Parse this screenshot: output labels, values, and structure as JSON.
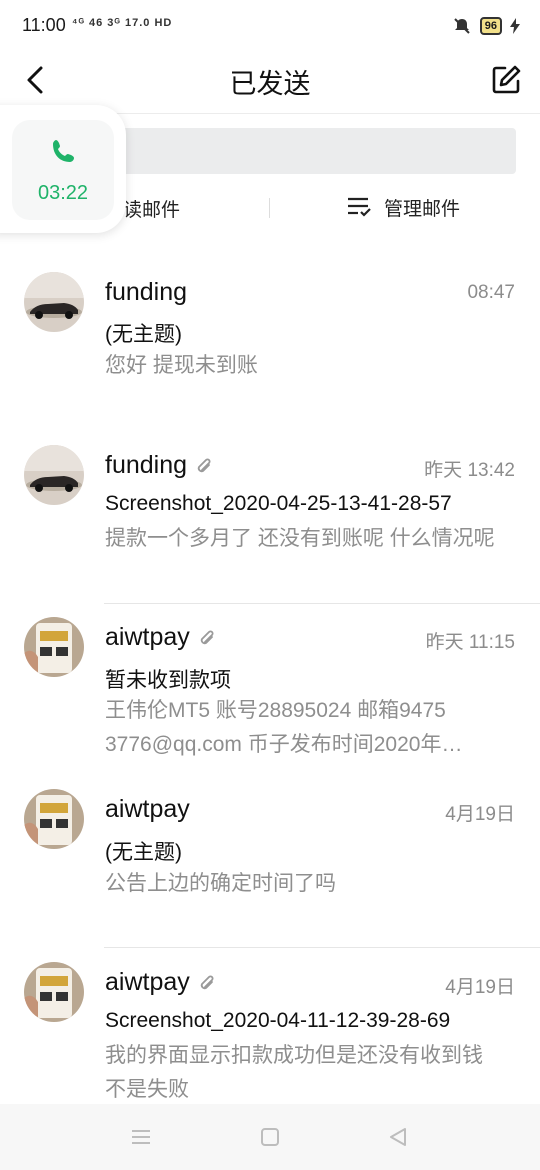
{
  "status_bar": {
    "time": "11:00",
    "network": "⁴ᴳ 46 3ᴳ 17.0 HD",
    "battery": "96"
  },
  "header": {
    "title": "已发送",
    "back_icon": "chevron-left-icon",
    "compose_icon": "compose-icon"
  },
  "search": {
    "placeholder": ""
  },
  "actions": {
    "unread_label": "未读邮件",
    "manage_label": "管理邮件"
  },
  "call_widget": {
    "timer": "03:22",
    "icon": "phone-icon",
    "accent": "#1fb369"
  },
  "mails": [
    {
      "sender": "funding",
      "time": "08:47",
      "subject": "(无主题)",
      "preview": "您好 提现未到账",
      "has_attachment": false,
      "avatar": "car"
    },
    {
      "sender": "funding",
      "time": "昨天 13:42",
      "subject": "Screenshot_2020-04-25-13-41-28-57",
      "preview": "提款一个多月了 还没有到账呢 什么情况呢",
      "has_attachment": true,
      "avatar": "car"
    },
    {
      "sender": "aiwtpay",
      "time": "昨天 11:15",
      "subject": "暂未收到款项",
      "preview": "王伟伦MT5 账号28895024 邮箱9475 3776@qq.com 币子发布时间2020年…",
      "has_attachment": true,
      "avatar": "phone"
    },
    {
      "sender": "aiwtpay",
      "time": "4月19日",
      "subject": "(无主题)",
      "preview": "公告上边的确定时间了吗",
      "has_attachment": false,
      "avatar": "phone"
    },
    {
      "sender": "aiwtpay",
      "time": "4月19日",
      "subject": "Screenshot_2020-04-11-12-39-28-69",
      "preview": "我的界面显示扣款成功但是还没有收到钱 不是失败",
      "has_attachment": true,
      "avatar": "phone"
    }
  ],
  "system_nav": {
    "menu_icon": "menu-icon",
    "home_icon": "home-icon",
    "back_icon": "back-triangle-icon"
  }
}
